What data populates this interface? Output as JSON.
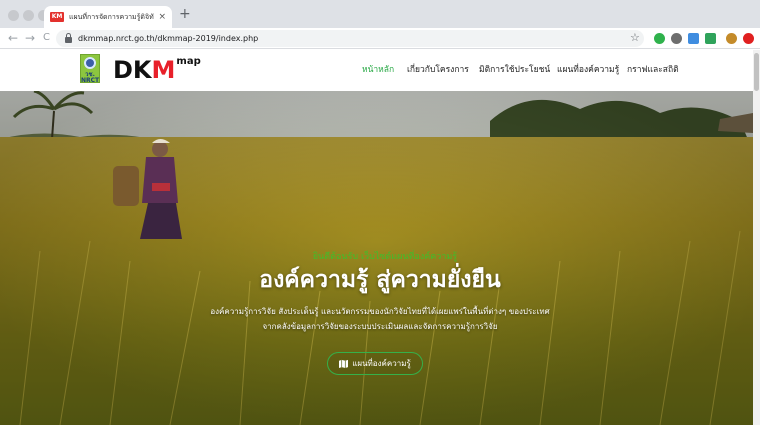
{
  "browser": {
    "tab": {
      "favicon_text": "KM",
      "title": "แผนที่การจัดการความรู้ดิจิทัล::DKM",
      "close_symbol": "×"
    },
    "new_tab_symbol": "+",
    "url": "dkmmap.nrct.go.th/dkmmap-2019/index.php",
    "nav": {
      "back": "←",
      "forward": "→",
      "reload": "C"
    },
    "star_symbol": "☆",
    "extension_colors": [
      "#2fb24c",
      "#6e6e6e",
      "#3f8de0",
      "#2fa35b",
      "#c48b2a",
      "#e02020"
    ]
  },
  "site": {
    "logo": {
      "badge_year": "วช. NRCT",
      "word_dk": "DK",
      "word_m": "M",
      "word_map": "map",
      "brand_green": "#8cc63f",
      "brand_red": "#e8202a"
    },
    "menu": [
      {
        "label": "หน้าหลัก",
        "active": true
      },
      {
        "label": "เกี่ยวกับโครงการ",
        "active": false
      },
      {
        "label": "มิติการใช้ประโยชน์",
        "active": false
      },
      {
        "label": "แผนที่องค์ความรู้",
        "active": false
      },
      {
        "label": "กราฟและสถิติ",
        "active": false
      }
    ],
    "accent_color": "#27a844"
  },
  "hero": {
    "subtitle": "ยินดีต้อนรับ เว็บไซต์แผนที่องค์ความรู้",
    "title": "องค์ความรู้ สู่ความยั่งยืน",
    "description_line1": "องค์ความรู้การวิจัย สังประเด็นรู้ และนวัตกรรมของนักวิจัยไทยที่ได้เผยแพร่ในพื้นที่ต่างๆ ของประเทศ",
    "description_line2": "จากคลังข้อมูลการวิจัยของระบบประเมินผลและจัดการความรู้การวิจัย",
    "button_label": "แผนที่องค์ความรู้",
    "button_icon": "map-icon"
  }
}
